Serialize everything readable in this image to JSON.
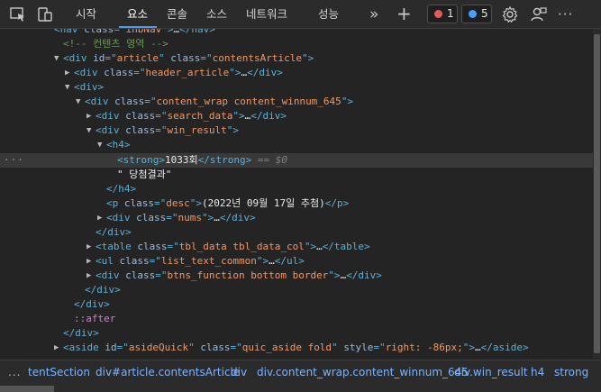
{
  "toolbar": {
    "inspect_icon": "inspect-icon",
    "device_icon": "device-emulation-icon",
    "tabs": [
      "시작",
      "요소",
      "콘솔",
      "소스",
      "네트워크",
      "성능"
    ],
    "active_tab": "요소",
    "more_tabs_glyph": "»",
    "add_tab_glyph": "+",
    "errors_count": "1",
    "issues_count": "5",
    "error_color": "#e35b5b",
    "issue_color": "#4a9df8",
    "more_menu_glyph": "···"
  },
  "tree": {
    "lines": [
      {
        "indent": 0,
        "raw": "<nav class= inbNav >…</nav>"
      },
      {
        "indent": 1,
        "comment": "<!-- 컨텐츠 영역 -->"
      },
      {
        "tag_open": "div",
        "attrs": "id=\"article\" class=\"contentsArticle\""
      },
      {
        "tag_open": "div",
        "attrs": "class=\"header_article\"",
        "collapsed": "…</div>"
      },
      {
        "tag": "<div>"
      },
      {
        "tag_open": "div",
        "attrs": "class=\"content_wrap content_winnum_645\""
      },
      {
        "tag_open": "div",
        "attrs": "class=\"search_data\"",
        "collapsed": "…</div>"
      },
      {
        "tag_open": "div",
        "attrs": "class=\"win_result\""
      },
      {
        "tag": "<h4>"
      },
      {
        "strong_text": "1033회",
        "dollar": "== $0"
      },
      {
        "text": "\" 당첨결과\""
      },
      {
        "close": "</h4>"
      },
      {
        "p_text": "(2022년 09월 17일 추첨)"
      },
      {
        "tag_open": "div",
        "attrs": "class=\"nums\"",
        "collapsed": "…</div>"
      },
      {
        "close": "</div>"
      },
      {
        "tag_open": "table",
        "attrs": "class=\"tbl_data tbl_data_col\"",
        "collapsed": "…</table>"
      },
      {
        "tag_open": "ul",
        "attrs": "class=\"list_text_common\"",
        "collapsed": "…</ul>"
      },
      {
        "tag_open": "div",
        "attrs": "class=\"btns_function bottom border\"",
        "collapsed": "…</div>"
      },
      {
        "close": "</div>"
      },
      {
        "close": "</div>"
      },
      {
        "pseudo": "::after"
      },
      {
        "close": "</div>"
      },
      {
        "tag_open": "aside",
        "attrs": "id=\"asideQuick\" class=\"quic_aside fold\" style=\"right: -86px;\"",
        "collapsed": "…</aside>"
      }
    ]
  },
  "breadcrumb": {
    "more": "...",
    "items": [
      "tentSection",
      "div#article.contentsArticle",
      "div",
      "div.content_wrap.content_winnum_645",
      "div.win_result",
      "h4",
      "strong"
    ]
  }
}
